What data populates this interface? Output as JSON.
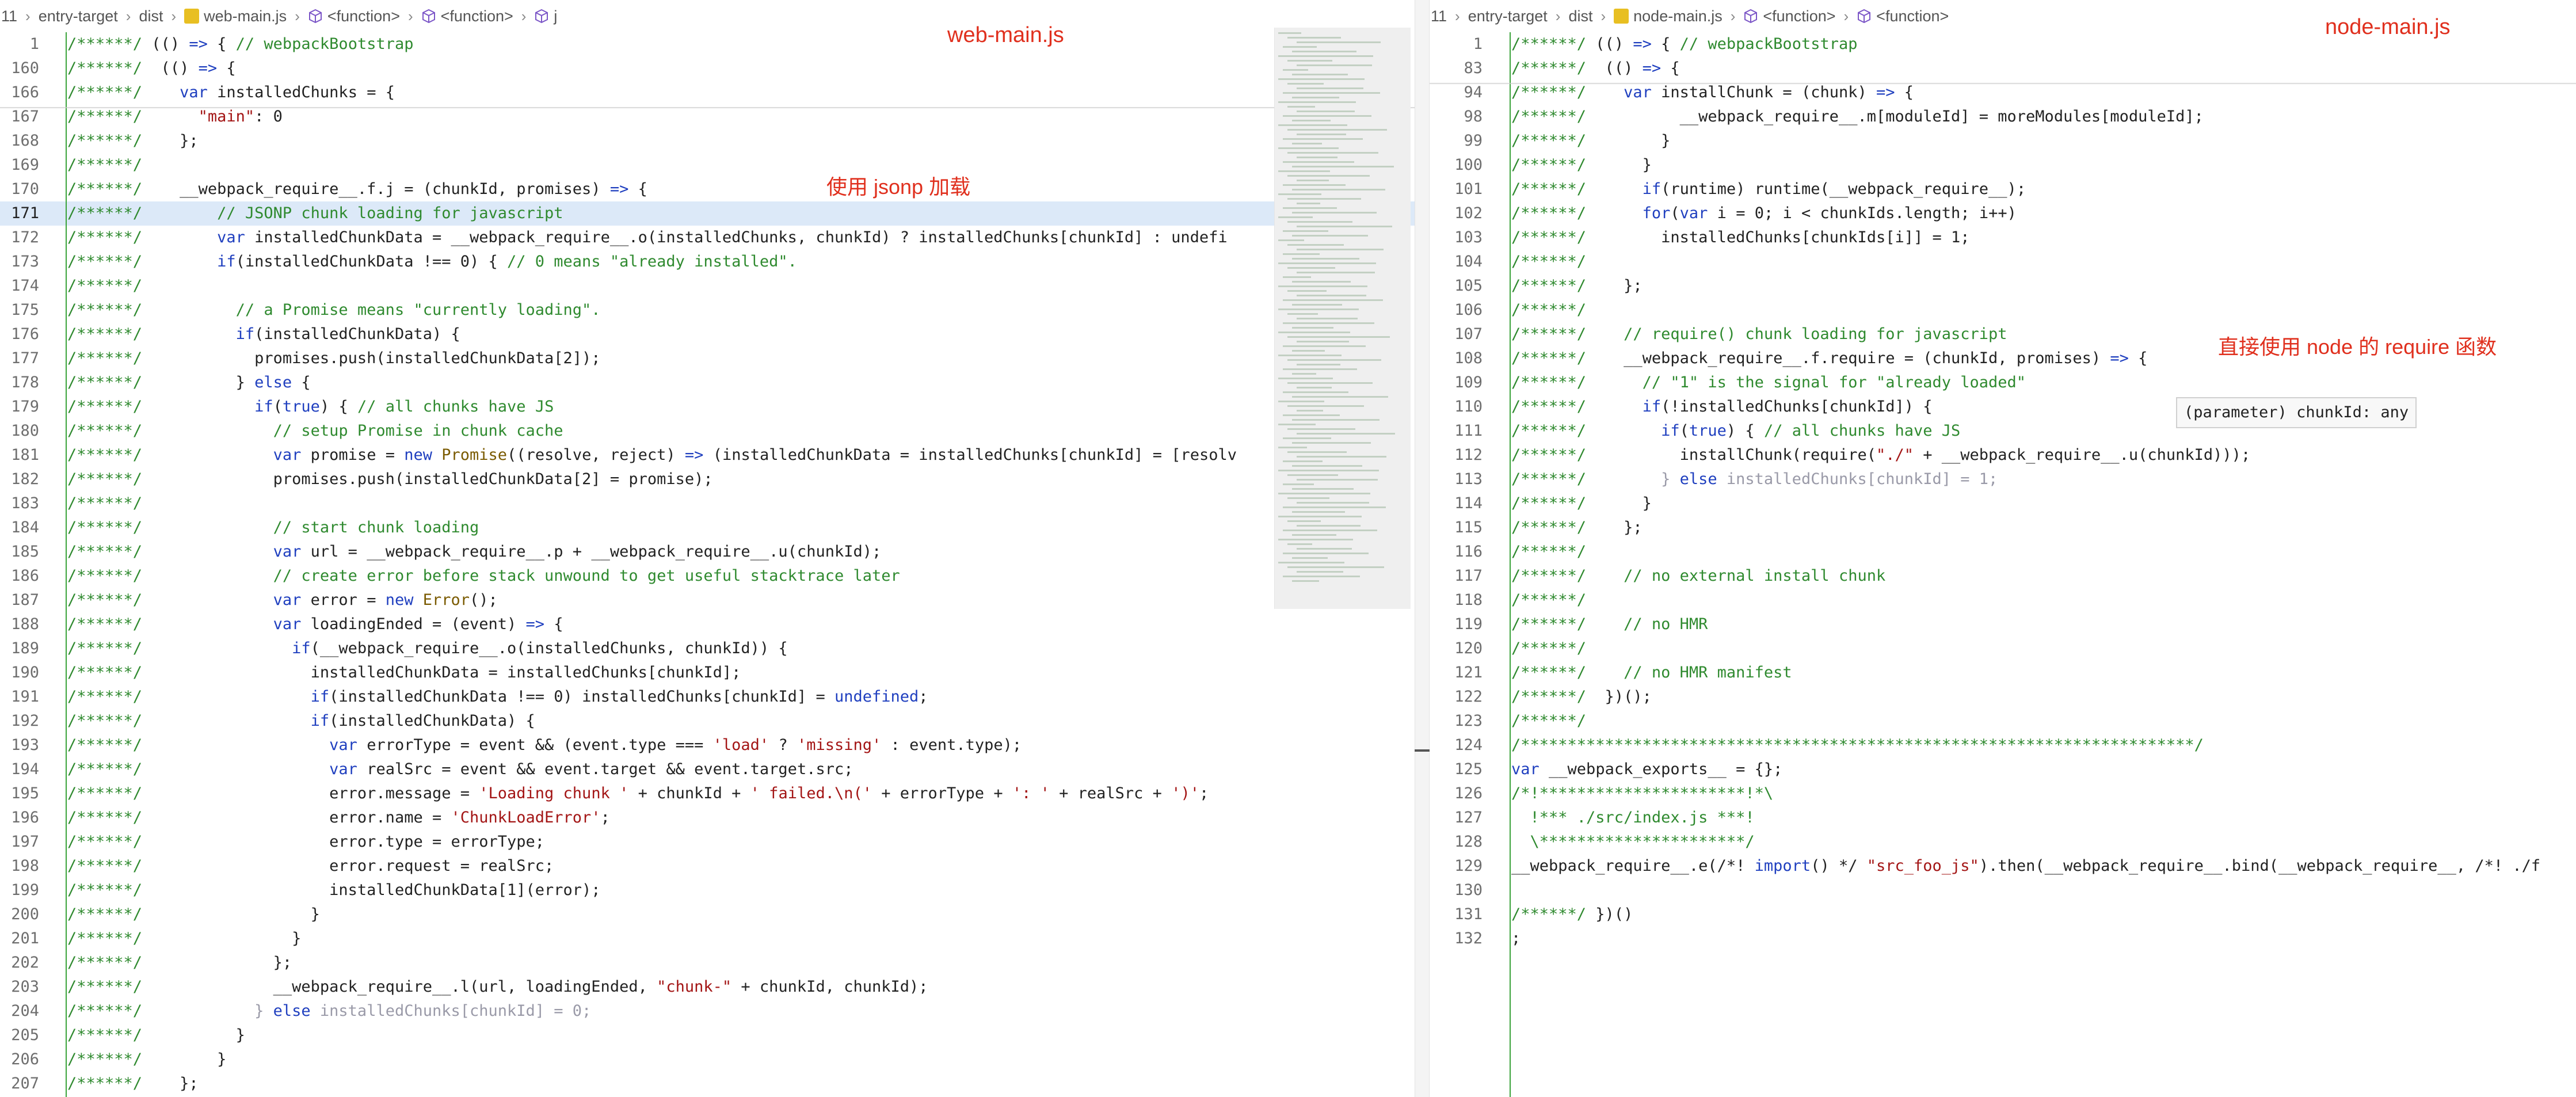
{
  "left": {
    "breadcrumb": [
      "11",
      "entry-target",
      "dist",
      "web-main.js",
      "<function>",
      "<function>",
      "j"
    ],
    "title_label": "web-main.js",
    "annotation": "使用 jsonp 加载",
    "lines": [
      {
        "n": "1",
        "t": "/******/ (() => { // webpackBootstrap"
      },
      {
        "n": "160",
        "t": "/******/  (() => {"
      },
      {
        "n": "166",
        "t": "/******/    var installedChunks = {"
      },
      {
        "n": "167",
        "t": "/******/      \"main\": 0"
      },
      {
        "n": "168",
        "t": "/******/    };"
      },
      {
        "n": "169",
        "t": "/******/"
      },
      {
        "n": "170",
        "t": "/******/    __webpack_require__.f.j = (chunkId, promises) => {"
      },
      {
        "n": "171",
        "t": "/******/        // JSONP chunk loading for javascript"
      },
      {
        "n": "172",
        "t": "/******/        var installedChunkData = __webpack_require__.o(installedChunks, chunkId) ? installedChunks[chunkId] : undefi"
      },
      {
        "n": "173",
        "t": "/******/        if(installedChunkData !== 0) { // 0 means \"already installed\"."
      },
      {
        "n": "174",
        "t": "/******/"
      },
      {
        "n": "175",
        "t": "/******/          // a Promise means \"currently loading\"."
      },
      {
        "n": "176",
        "t": "/******/          if(installedChunkData) {"
      },
      {
        "n": "177",
        "t": "/******/            promises.push(installedChunkData[2]);"
      },
      {
        "n": "178",
        "t": "/******/          } else {"
      },
      {
        "n": "179",
        "t": "/******/            if(true) { // all chunks have JS"
      },
      {
        "n": "180",
        "t": "/******/              // setup Promise in chunk cache"
      },
      {
        "n": "181",
        "t": "/******/              var promise = new Promise((resolve, reject) => (installedChunkData = installedChunks[chunkId] = [resolv"
      },
      {
        "n": "182",
        "t": "/******/              promises.push(installedChunkData[2] = promise);"
      },
      {
        "n": "183",
        "t": "/******/"
      },
      {
        "n": "184",
        "t": "/******/              // start chunk loading"
      },
      {
        "n": "185",
        "t": "/******/              var url = __webpack_require__.p + __webpack_require__.u(chunkId);"
      },
      {
        "n": "186",
        "t": "/******/              // create error before stack unwound to get useful stacktrace later"
      },
      {
        "n": "187",
        "t": "/******/              var error = new Error();"
      },
      {
        "n": "188",
        "t": "/******/              var loadingEnded = (event) => {"
      },
      {
        "n": "189",
        "t": "/******/                if(__webpack_require__.o(installedChunks, chunkId)) {"
      },
      {
        "n": "190",
        "t": "/******/                  installedChunkData = installedChunks[chunkId];"
      },
      {
        "n": "191",
        "t": "/******/                  if(installedChunkData !== 0) installedChunks[chunkId] = undefined;"
      },
      {
        "n": "192",
        "t": "/******/                  if(installedChunkData) {"
      },
      {
        "n": "193",
        "t": "/******/                    var errorType = event && (event.type === 'load' ? 'missing' : event.type);"
      },
      {
        "n": "194",
        "t": "/******/                    var realSrc = event && event.target && event.target.src;"
      },
      {
        "n": "195",
        "t": "/******/                    error.message = 'Loading chunk ' + chunkId + ' failed.\\n(' + errorType + ': ' + realSrc + ')';"
      },
      {
        "n": "196",
        "t": "/******/                    error.name = 'ChunkLoadError';"
      },
      {
        "n": "197",
        "t": "/******/                    error.type = errorType;"
      },
      {
        "n": "198",
        "t": "/******/                    error.request = realSrc;"
      },
      {
        "n": "199",
        "t": "/******/                    installedChunkData[1](error);"
      },
      {
        "n": "200",
        "t": "/******/                  }"
      },
      {
        "n": "201",
        "t": "/******/                }"
      },
      {
        "n": "202",
        "t": "/******/              };"
      },
      {
        "n": "203",
        "t": "/******/              __webpack_require__.l(url, loadingEnded, \"chunk-\" + chunkId, chunkId);"
      },
      {
        "n": "204",
        "t": "/******/            } else installedChunks[chunkId] = 0;"
      },
      {
        "n": "205",
        "t": "/******/          }"
      },
      {
        "n": "206",
        "t": "/******/        }"
      },
      {
        "n": "207",
        "t": "/******/    };"
      }
    ]
  },
  "right": {
    "breadcrumb": [
      "11",
      "entry-target",
      "dist",
      "node-main.js",
      "<function>",
      "<function>"
    ],
    "title_label": "node-main.js",
    "annotation": "直接使用 node 的 require 函数",
    "tooltip": "(parameter) chunkId: any",
    "lines": [
      {
        "n": "1",
        "t": "/******/ (() => { // webpackBootstrap"
      },
      {
        "n": "83",
        "t": "/******/  (() => {"
      },
      {
        "n": "94",
        "t": "/******/    var installChunk = (chunk) => {"
      },
      {
        "n": "98",
        "t": "/******/          __webpack_require__.m[moduleId] = moreModules[moduleId];"
      },
      {
        "n": "99",
        "t": "/******/        }"
      },
      {
        "n": "100",
        "t": "/******/      }"
      },
      {
        "n": "101",
        "t": "/******/      if(runtime) runtime(__webpack_require__);"
      },
      {
        "n": "102",
        "t": "/******/      for(var i = 0; i < chunkIds.length; i++)"
      },
      {
        "n": "103",
        "t": "/******/        installedChunks[chunkIds[i]] = 1;"
      },
      {
        "n": "104",
        "t": "/******/"
      },
      {
        "n": "105",
        "t": "/******/    };"
      },
      {
        "n": "106",
        "t": "/******/"
      },
      {
        "n": "107",
        "t": "/******/    // require() chunk loading for javascript"
      },
      {
        "n": "108",
        "t": "/******/    __webpack_require__.f.require = (chunkId, promises) => {"
      },
      {
        "n": "109",
        "t": "/******/      // \"1\" is the signal for \"already loaded\""
      },
      {
        "n": "110",
        "t": "/******/      if(!installedChunks[chunkId]) {"
      },
      {
        "n": "111",
        "t": "/******/        if(true) { // all chunks have JS"
      },
      {
        "n": "112",
        "t": "/******/          installChunk(require(\"./\" + __webpack_require__.u(chunkId)));"
      },
      {
        "n": "113",
        "t": "/******/        } else installedChunks[chunkId] = 1;"
      },
      {
        "n": "114",
        "t": "/******/      }"
      },
      {
        "n": "115",
        "t": "/******/    };"
      },
      {
        "n": "116",
        "t": "/******/"
      },
      {
        "n": "117",
        "t": "/******/    // no external install chunk"
      },
      {
        "n": "118",
        "t": "/******/"
      },
      {
        "n": "119",
        "t": "/******/    // no HMR"
      },
      {
        "n": "120",
        "t": "/******/"
      },
      {
        "n": "121",
        "t": "/******/    // no HMR manifest"
      },
      {
        "n": "122",
        "t": "/******/  })();"
      },
      {
        "n": "123",
        "t": "/******/"
      },
      {
        "n": "124",
        "t": "/************************************************************************/"
      },
      {
        "n": "125",
        "t": "var __webpack_exports__ = {};"
      },
      {
        "n": "126",
        "t": "/*!**********************!*\\"
      },
      {
        "n": "127",
        "t": "  !*** ./src/index.js ***!"
      },
      {
        "n": "128",
        "t": "  \\**********************/"
      },
      {
        "n": "129",
        "t": "__webpack_require__.e(/*! import() */ \"src_foo_js\").then(__webpack_require__.bind(__webpack_require__, /*! ./f"
      },
      {
        "n": "130",
        "t": ""
      },
      {
        "n": "131",
        "t": "/******/ })()"
      },
      {
        "n": "132",
        "t": ";"
      }
    ]
  },
  "colors": {
    "comment": "#2f8a2f",
    "keyword": "#1f3fbf",
    "string": "#a31515",
    "number": "#0b8a61",
    "annotation": "#e0301e",
    "highlight": "#dce9f8"
  }
}
